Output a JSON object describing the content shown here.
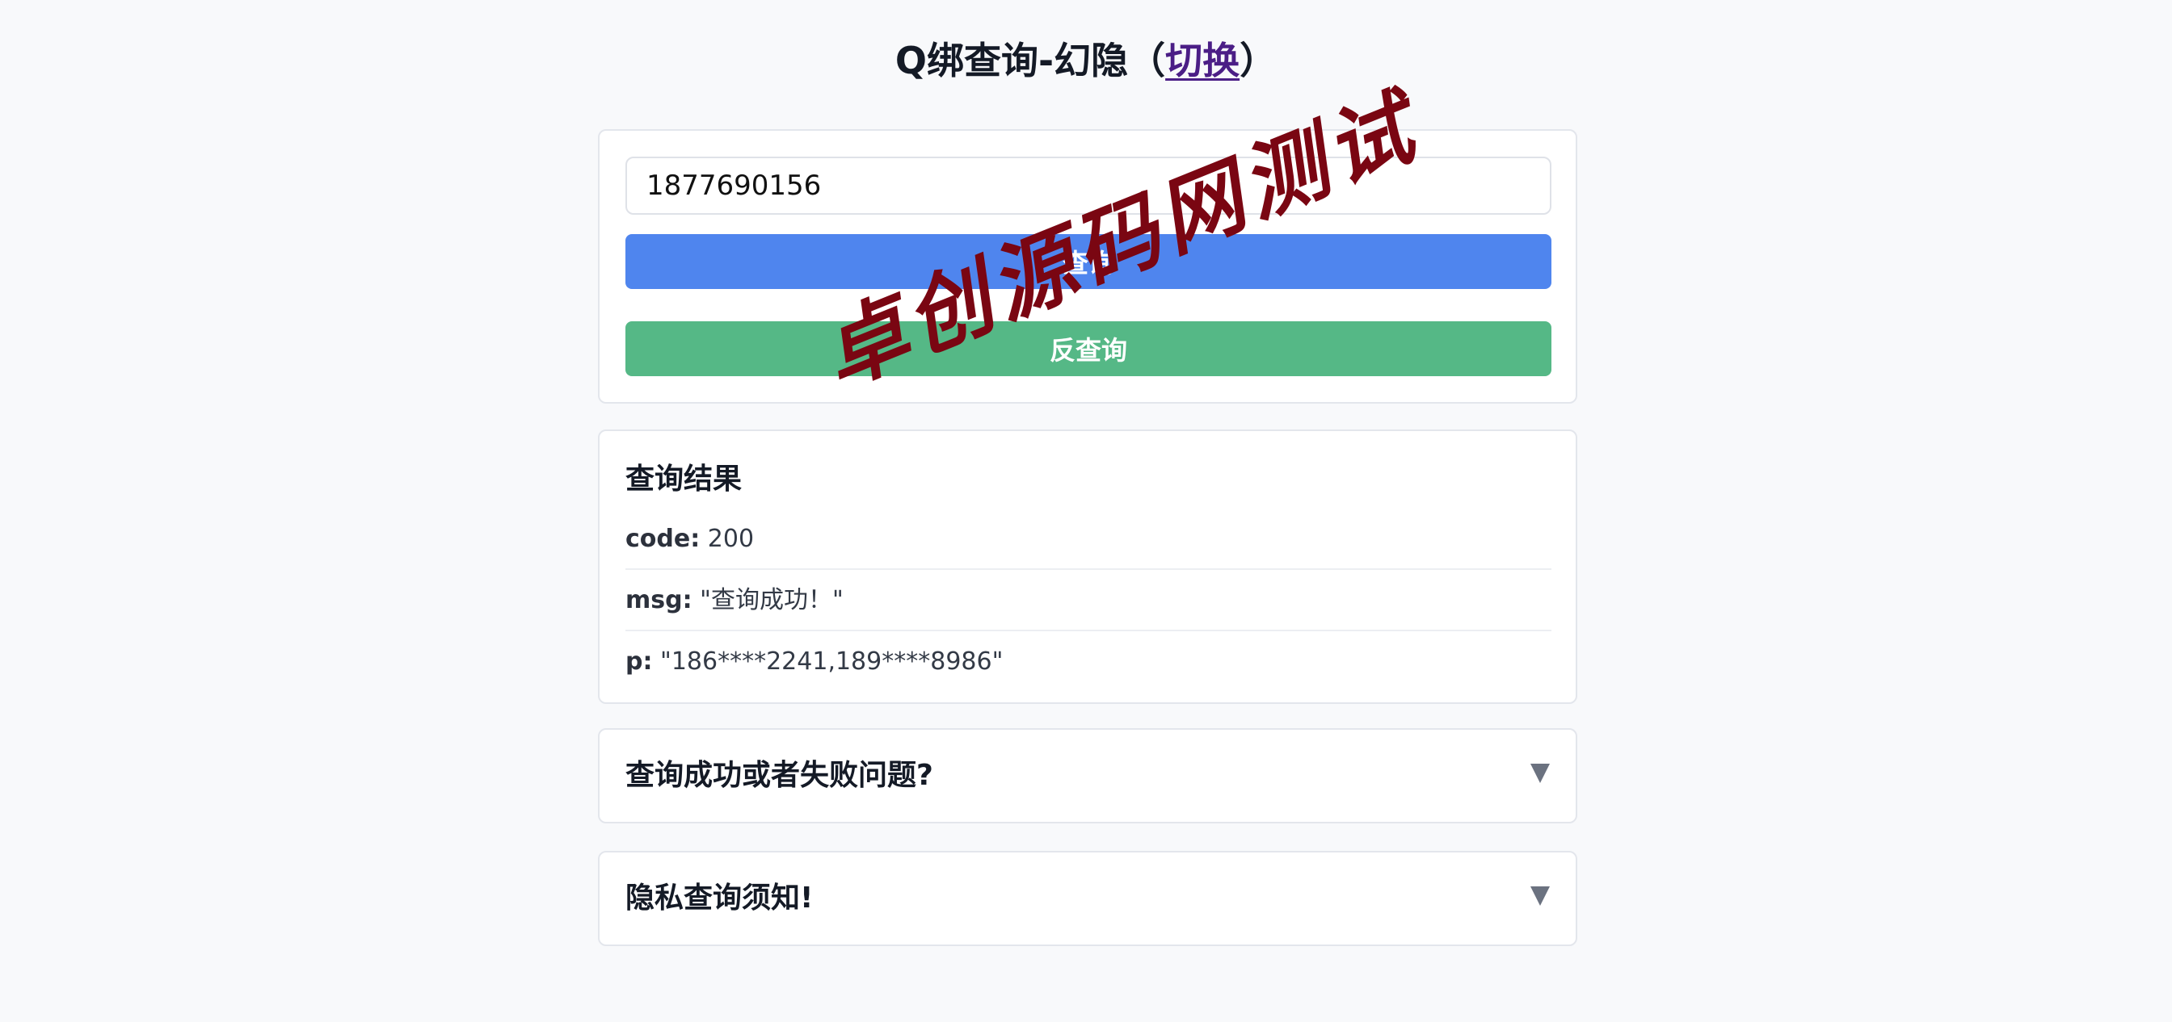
{
  "header": {
    "title_prefix": "Q绑查询-幻隐（",
    "switch_link": "切换",
    "title_suffix": "）"
  },
  "search": {
    "input_value": "1877690156",
    "query_label": "查询",
    "reverse_label": "反查询"
  },
  "result": {
    "heading": "查询结果",
    "rows": [
      {
        "key": "code:",
        "value": "200"
      },
      {
        "key": "msg:",
        "value": "\"查询成功！\""
      },
      {
        "key": "p:",
        "value": "\"186****2241,189****8986\""
      }
    ]
  },
  "faq": [
    {
      "title": "查询成功或者失败问题?"
    },
    {
      "title": "隐私查询须知!"
    }
  ],
  "watermark": {
    "text": "卓创源码网测试"
  },
  "colors": {
    "query_button": "#4f85ee",
    "reverse_button": "#55b886",
    "link": "#4b1e86",
    "watermark": "#7a0612"
  }
}
